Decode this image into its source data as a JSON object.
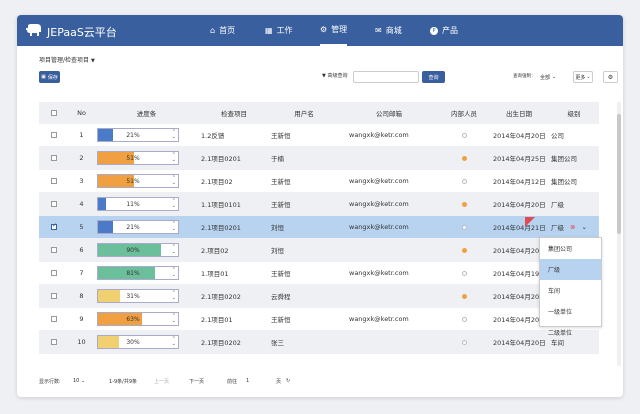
{
  "app": {
    "title": "JEPaaS云平台"
  },
  "nav": [
    {
      "label": "首页",
      "icon": "home-icon",
      "glyph": "⌂"
    },
    {
      "label": "工作",
      "icon": "grid-icon",
      "glyph": "▦"
    },
    {
      "label": "管理",
      "icon": "gear-icon",
      "glyph": "⚙"
    },
    {
      "label": "商城",
      "icon": "mail-icon",
      "glyph": "✉"
    },
    {
      "label": "产品",
      "icon": "product-icon",
      "glyph": "P"
    }
  ],
  "breadcrumb": "项目管理/检查项目",
  "toolbar": {
    "save_label": "保存",
    "adv_search_label": "高级查询",
    "search_placeholder": "",
    "query_label": "查询",
    "filter_label": "查询强制：",
    "filter_value": "全部",
    "more_label": "更多"
  },
  "table": {
    "headers": [
      "No",
      "进度条",
      "检查项目",
      "用户名",
      "公司邮箱",
      "内部人员",
      "出生日期",
      "级别"
    ],
    "rows": [
      {
        "no": "1",
        "progress": 21,
        "progress_label": "21%",
        "color": "#4a7ac8",
        "item": "1.2反馈",
        "user": "王新恒",
        "email": "wangxk@ketr.com",
        "internal": false,
        "date": "2014年04月20日",
        "level": "公司",
        "checked": false
      },
      {
        "no": "2",
        "progress": 51,
        "progress_label": "51%",
        "color": "#f0a040",
        "item": "2.1项目0201",
        "user": "于楠",
        "email": "",
        "internal": true,
        "date": "2014年04月25日",
        "level": "集团公司",
        "checked": false
      },
      {
        "no": "3",
        "progress": 51,
        "progress_label": "51%",
        "color": "#f0a040",
        "item": "2.1项目02",
        "user": "王新恒",
        "email": "wangxk@ketr.com",
        "internal": false,
        "date": "2014年04月12日",
        "level": "集团公司",
        "checked": false
      },
      {
        "no": "4",
        "progress": 11,
        "progress_label": "11%",
        "color": "#4a7ac8",
        "item": "1.1项目0101",
        "user": "王新恒",
        "email": "wangxk@ketr.com",
        "internal": true,
        "date": "2014年04月20日",
        "level": "厂级",
        "checked": false
      },
      {
        "no": "5",
        "progress": 21,
        "progress_label": "21%",
        "color": "#4a7ac8",
        "item": "2.1项目0201",
        "user": "刘恒",
        "email": "wangxk@ketr.com",
        "internal": false,
        "date": "2014年04月21日",
        "level": "厂级",
        "checked": true
      },
      {
        "no": "6",
        "progress": 90,
        "progress_label": "90%",
        "color": "#6bbf9a",
        "item": "2.项目02",
        "user": "刘恒",
        "email": "",
        "internal": true,
        "date": "2014年04月20日",
        "level": "",
        "checked": false
      },
      {
        "no": "7",
        "progress": 81,
        "progress_label": "81%",
        "color": "#6bbf9a",
        "item": "1.项目01",
        "user": "王新恒",
        "email": "wangxk@ketr.com",
        "internal": false,
        "date": "2014年04月19日",
        "level": "",
        "checked": false
      },
      {
        "no": "8",
        "progress": 31,
        "progress_label": "31%",
        "color": "#f0d070",
        "item": "2.1项目0202",
        "user": "云舜程",
        "email": "",
        "internal": true,
        "date": "2014年04月20日",
        "level": "",
        "checked": false
      },
      {
        "no": "9",
        "progress": 63,
        "progress_label": "63%",
        "color": "#f0a040",
        "item": "2.1项目01",
        "user": "王新恒",
        "email": "wangxk@ketr.com",
        "internal": false,
        "date": "2014年04月20日",
        "level": "",
        "checked": false
      },
      {
        "no": "10",
        "progress": 30,
        "progress_label": "30%",
        "color": "#f0d070",
        "item": "2.1项目0202",
        "user": "张三",
        "email": "",
        "internal": false,
        "date": "2014年04月20日",
        "level": "车间",
        "checked": false
      }
    ]
  },
  "dropdown": {
    "selected": "厂级",
    "options": [
      "集团公司",
      "厂级",
      "车间",
      "一级单位",
      "二级单位"
    ],
    "highlighted": "厂级"
  },
  "footer": {
    "rows_label": "显示行数:",
    "rows_value": "10",
    "range_text": "1-9条/共9条",
    "prev_label": "上一页",
    "next_label": "下一页",
    "goto_label": "前往",
    "page_value": "1",
    "page_suffix": "页"
  }
}
